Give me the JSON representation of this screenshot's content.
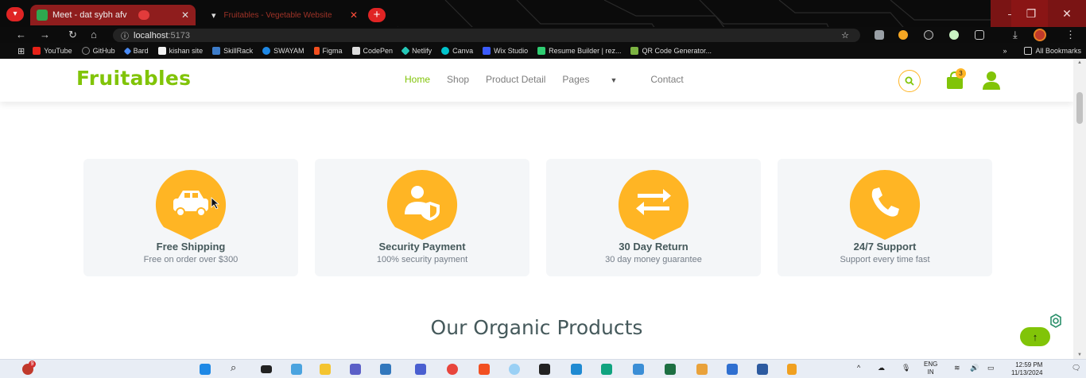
{
  "browser": {
    "tabs": [
      {
        "title": "Meet - dat sybh afv",
        "active": true
      },
      {
        "title": "Fruitables - Vegetable Website",
        "active": false
      }
    ],
    "new_tab": "+",
    "url_host": "localhost",
    "url_port": ":5173",
    "bookmarks": [
      "YouTube",
      "GitHub",
      "Bard",
      "kishan site",
      "SkillRack",
      "SWAYAM",
      "Figma",
      "CodePen",
      "Netlify",
      "Canva",
      "Wix Studio",
      "Resume Builder | rez...",
      "QR Code Generator..."
    ],
    "all_bookmarks": "All Bookmarks",
    "more_bookmarks": "»",
    "window_controls": {
      "minimize": "—",
      "maximize": "❐",
      "close": "✕"
    }
  },
  "site": {
    "logo": "Fruitables",
    "nav": [
      "Home",
      "Shop",
      "Product Detail",
      "Pages",
      "Contact"
    ],
    "nav_active": "Home",
    "cart_count": "3"
  },
  "features": [
    {
      "icon": "car-icon",
      "title": "Free Shipping",
      "desc": "Free on order over $300"
    },
    {
      "icon": "user-shield-icon",
      "title": "Security Payment",
      "desc": "100% security payment"
    },
    {
      "icon": "exchange-icon",
      "title": "30 Day Return",
      "desc": "30 day money guarantee"
    },
    {
      "icon": "phone-icon",
      "title": "24/7 Support",
      "desc": "Support every time fast"
    }
  ],
  "section_title": "Our Organic Products",
  "taskbar": {
    "lang_top": "ENG",
    "lang_bottom": "IN",
    "time": "12:59 PM",
    "date": "11/13/2024",
    "notification_count": "9"
  },
  "colors": {
    "brand_green": "#81c408",
    "accent_yellow": "#ffb524",
    "text_dark": "#45595b"
  }
}
